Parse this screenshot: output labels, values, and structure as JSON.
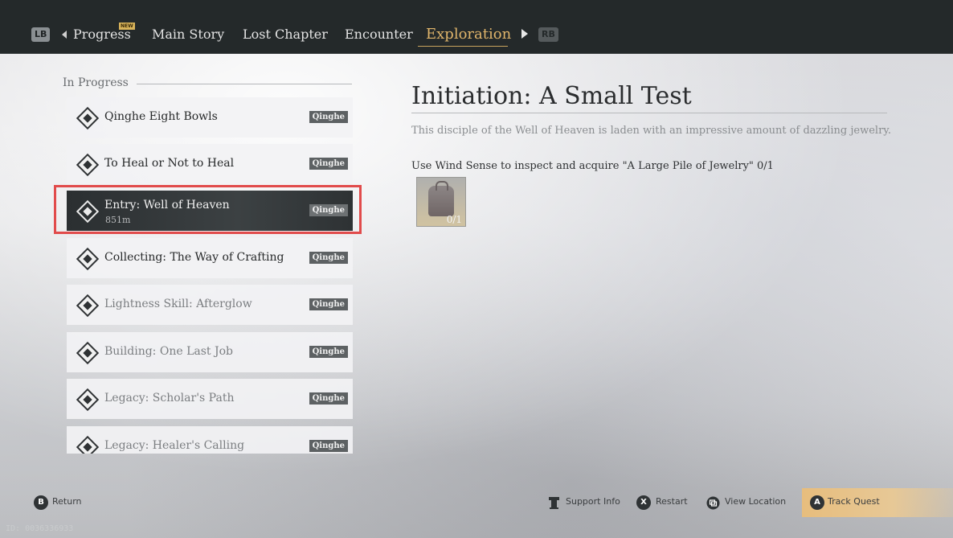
{
  "nav": {
    "left_button": "LB",
    "right_button": "RB",
    "new_badge": "NEW",
    "tabs": [
      "Progress",
      "Main Story",
      "Lost Chapter",
      "Encounter",
      "Exploration"
    ],
    "active_tab": "Exploration"
  },
  "list": {
    "section_title": "In Progress",
    "quests": [
      {
        "name": "Qinghe Eight Bowls",
        "region": "Qinghe"
      },
      {
        "name": "To Heal or Not to Heal",
        "region": "Qinghe"
      },
      {
        "name": "Entry: Well of Heaven",
        "region": "Qinghe",
        "distance": "851m"
      },
      {
        "name": "Collecting: The Way of Crafting",
        "region": "Qinghe"
      },
      {
        "name": "Lightness Skill: Afterglow",
        "region": "Qinghe"
      },
      {
        "name": "Building: One Last Job",
        "region": "Qinghe"
      },
      {
        "name": "Legacy: Scholar's Path",
        "region": "Qinghe"
      },
      {
        "name": "Legacy: Healer's Calling",
        "region": "Qinghe"
      }
    ]
  },
  "detail": {
    "title": "Initiation: A Small Test",
    "description": "This disciple of the Well of Heaven is laden with an impressive amount of dazzling jewelry.",
    "objective": "Use Wind Sense to inspect and acquire \"A Large Pile of Jewelry\" 0/1",
    "item_count": "0/1"
  },
  "footer": {
    "return_key": "B",
    "return_label": "Return",
    "support_label": "Support Info",
    "restart_key": "X",
    "restart_label": "Restart",
    "view_label": "View Location",
    "track_key": "A",
    "track_label": "Track Quest"
  },
  "id_text": "ID: 0036336933",
  "colors": {
    "accent": "#e0b56b",
    "highlight": "#e14b4b",
    "track": "#e7bd7d"
  }
}
